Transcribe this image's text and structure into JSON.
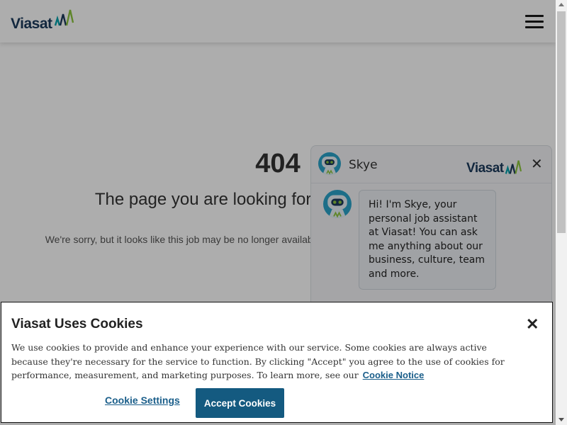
{
  "header": {
    "logo_text": "Viasat",
    "menu_icon": "hamburger-menu-icon"
  },
  "error_page": {
    "code": "404",
    "title": "The page you are looking for could not be found.",
    "message": "We're sorry, but it looks like this job may be no longer available or does not exist. Please try a new search."
  },
  "chat": {
    "bot_name": "Skye",
    "brand_text": "Viasat",
    "close_icon": "close-icon",
    "greeting": "Hi! I'm Skye, your personal job assistant at Viasat! You can ask me anything about our business, culture, team and more."
  },
  "cookie_banner": {
    "title": "Viasat Uses Cookies",
    "body": "We use cookies to provide and enhance your experience with our service. Some cookies are always active because they're necessary for the service to function. By clicking \"Accept\" you agree to the use of cookies for performance, measurement, and marketing purposes. To learn more, see our",
    "notice_link": "Cookie Notice",
    "settings_label": "Cookie Settings",
    "accept_label": "Accept Cookies",
    "close_icon": "close-icon"
  },
  "colors": {
    "brand_navy": "#1b3a5c",
    "brand_green": "#8dc63f",
    "brand_teal": "#00a3ad",
    "accept_button": "#145a80",
    "link": "#1a5e8a"
  }
}
